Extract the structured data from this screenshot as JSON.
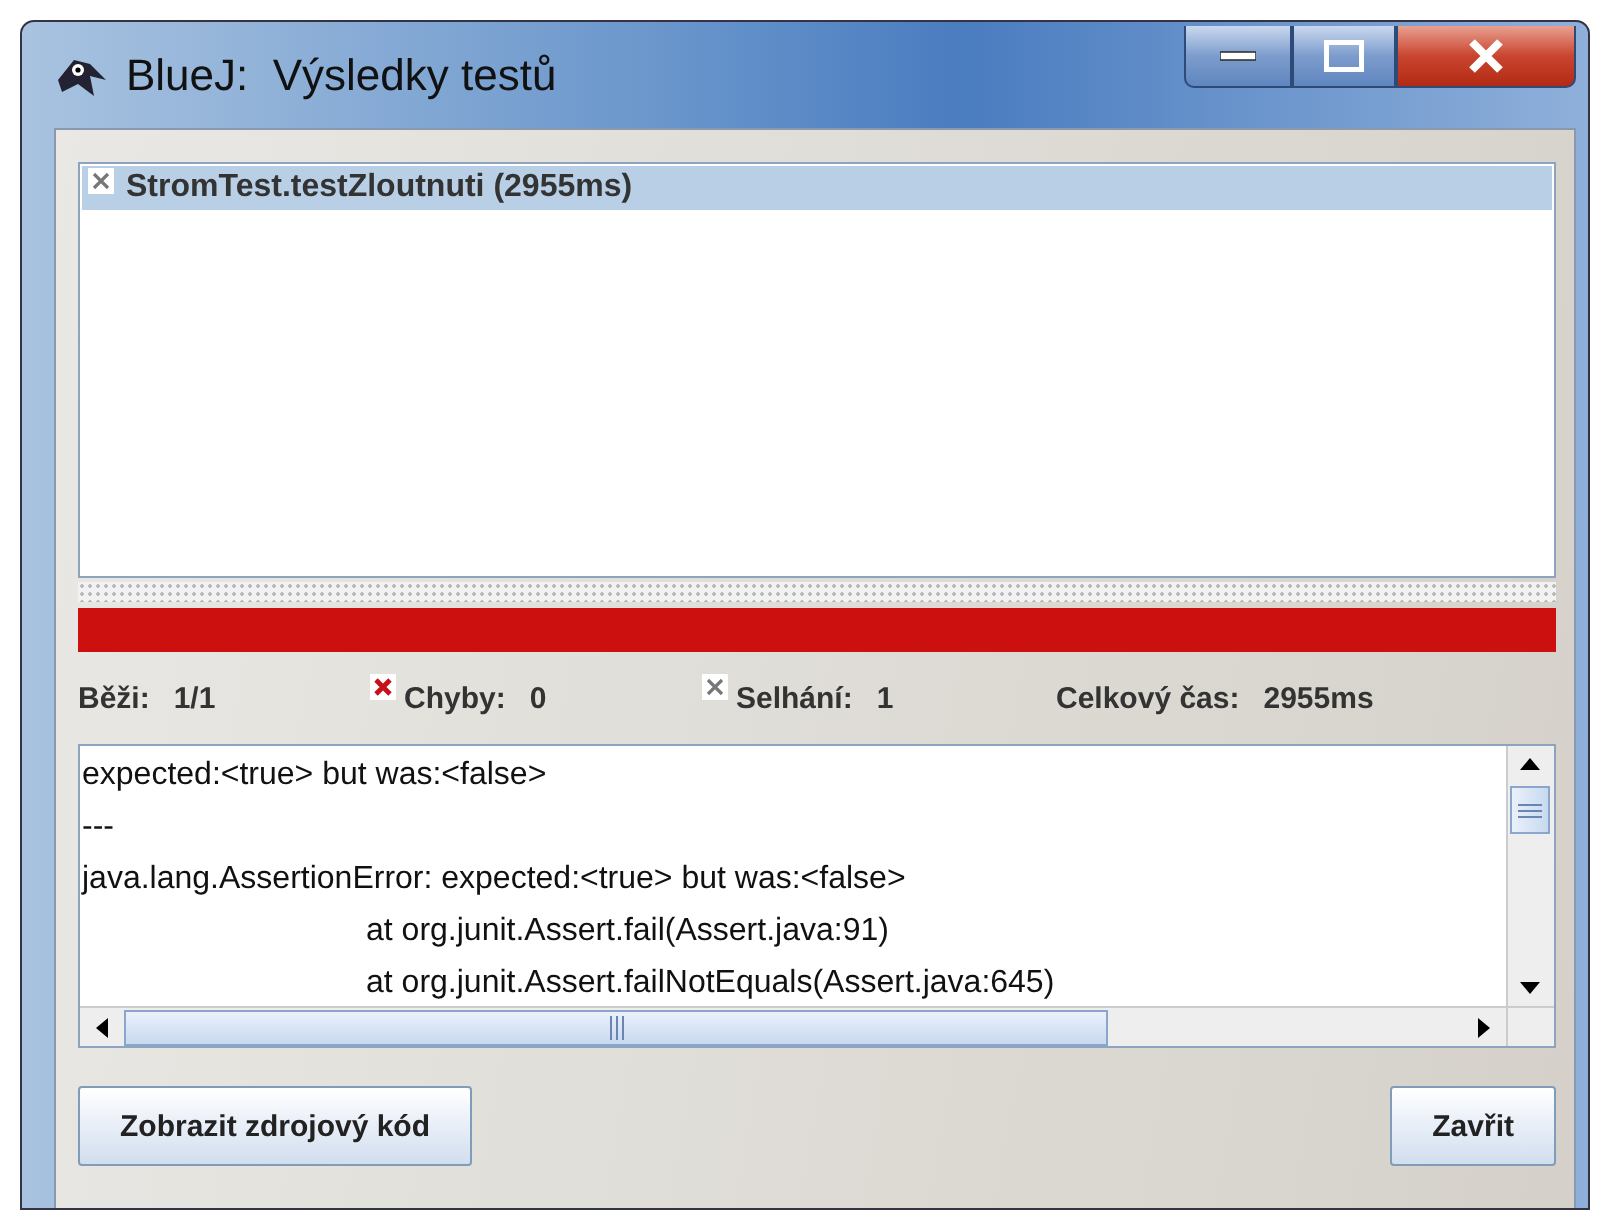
{
  "window": {
    "title": "BlueJ:  Výsledky testů"
  },
  "tests": [
    {
      "name": "StromTest.testZloutnuti (2955ms)",
      "kind": "failure",
      "selected": true
    }
  ],
  "progress": {
    "level": 1,
    "failed": true
  },
  "stats": [
    {
      "label": "Běži:",
      "value": "1/1",
      "kind": "plain"
    },
    {
      "label": "Chyby:",
      "value": "0",
      "kind": "error"
    },
    {
      "label": "Selhání:",
      "value": "1",
      "kind": "failure"
    },
    {
      "label": "Celkový čas:",
      "value": "2955ms",
      "kind": "plain"
    }
  ],
  "output": [
    {
      "text": "expected:<true> but was:<false>",
      "indented": false
    },
    {
      "text": "---",
      "indented": false
    },
    {
      "text": "java.lang.AssertionError: expected:<true> but was:<false>",
      "indented": false
    },
    {
      "text": "at org.junit.Assert.fail(Assert.java:91)",
      "indented": true
    },
    {
      "text": "at org.junit.Assert.failNotEquals(Assert.java:645)",
      "indented": true
    }
  ],
  "buttons": [
    "Zobrazit zdrojový kód",
    "Zavřit"
  ]
}
